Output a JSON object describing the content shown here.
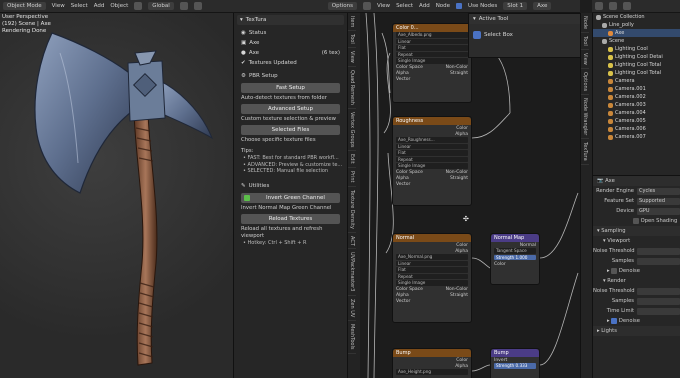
{
  "topbar": {
    "mode": "Object Mode",
    "menus": [
      "View",
      "Select",
      "Add",
      "Object"
    ],
    "orientation": "Global",
    "options": "Options"
  },
  "viewport": {
    "lines": [
      "User Perspective",
      "(192) Scene | Axe",
      "Rendering Done"
    ]
  },
  "panel": {
    "title": "TexTura",
    "status_title": "Status",
    "object_name": "Axe",
    "material_name": "Axe",
    "tex_count": "(6 tex)",
    "textures_updated": "Textures Updated",
    "pbr_title": "PBR Setup",
    "fast_setup": "Fast Setup",
    "fast_desc": "Auto-detect textures from folder",
    "advanced_setup": "Advanced Setup",
    "advanced_desc": "Custom texture selection & preview",
    "selected_files": "Selected Files",
    "selected_desc": "Choose specific texture files",
    "tips_label": "Tips:",
    "tips": [
      "• FAST: Best for standard PBR workfl...",
      "• ADVANCED: Preview & customize te...",
      "• SELECTED: Manual file selection"
    ],
    "utilities_title": "Utilities",
    "invert_green": "Invert Green Channel",
    "invert_desc": "Invert Normal Map Green Channel",
    "reload_textures": "Reload Textures",
    "reload_desc": "Reload all textures and refresh viewport",
    "hotkey": "• Hotkey: Ctrl + Shift + R"
  },
  "side_tabs": [
    "Item",
    "Tool",
    "View",
    "Quad Remesh",
    "Vertex Groups",
    "Edit",
    "Print",
    "Texture Density",
    "ACT",
    "UVPackmaster3",
    "Zen UV",
    "MeshTools"
  ],
  "node_editor": {
    "menus": [
      "View",
      "Select",
      "Add",
      "Node"
    ],
    "use_nodes": "Use Nodes",
    "slot": "Slot 1",
    "material": "Axe",
    "color_node": {
      "title": "Color 0...",
      "file": "Axe_Albedo.png"
    },
    "roughness_node": {
      "title": "Roughness",
      "file": "Axe_Roughness..."
    },
    "normal_node": {
      "title": "Normal",
      "file": "Axe_Normal.png"
    },
    "bump_node": {
      "title": "Bump",
      "file": "Axe_Height.png"
    },
    "fields": [
      "Linear",
      "Flat",
      "Repeat",
      "Single Image"
    ],
    "color_space_label": "Color Space",
    "color_space_value": "Non-Color",
    "alpha_label": "Alpha",
    "alpha_value": "Straight",
    "vector_label": "Vector",
    "out_color": "Color",
    "out_alpha": "Alpha",
    "normal_map": {
      "title": "Normal Map",
      "space": "Tangent Space",
      "strength_label": "Strength",
      "strength_value": "1.000",
      "out": "Normal",
      "in": "Color"
    },
    "bump": {
      "title": "Bump",
      "invert": "Invert",
      "strength_label": "Strength",
      "strength_value": "0.333"
    }
  },
  "active_tool": {
    "title": "Active Tool",
    "tool": "Select Box"
  },
  "right_tabs": [
    "Node",
    "Tool",
    "View",
    "Options",
    "Node Wrangler",
    "TexTura"
  ],
  "outliner": {
    "items": [
      {
        "label": "Scene Collection",
        "indent": 0
      },
      {
        "label": "Line_polly",
        "indent": 1
      },
      {
        "label": "Axe",
        "indent": 2,
        "selected": true
      },
      {
        "label": "Scene",
        "indent": 1
      },
      {
        "label": "Lighting Cool",
        "indent": 2
      },
      {
        "label": "Lighting Cool Detai",
        "indent": 2
      },
      {
        "label": "Lighting Cool Total",
        "indent": 2
      },
      {
        "label": "Lighting Cool Total",
        "indent": 2
      },
      {
        "label": "Camera",
        "indent": 2
      },
      {
        "label": "Camera.001",
        "indent": 2
      },
      {
        "label": "Camera.002",
        "indent": 2
      },
      {
        "label": "Camera.003",
        "indent": 2
      },
      {
        "label": "Camera.004",
        "indent": 2
      },
      {
        "label": "Camera.005",
        "indent": 2
      },
      {
        "label": "Camera.006",
        "indent": 2
      },
      {
        "label": "Camera.007",
        "indent": 2
      }
    ]
  },
  "properties": {
    "object": "Axe",
    "render_engine_label": "Render Engine",
    "render_engine": "Cycles",
    "feature_set_label": "Feature Set",
    "feature_set": "Supported",
    "device_label": "Device",
    "device": "GPU",
    "open_shading": "Open Shading",
    "sampling": "Sampling",
    "viewport": "Viewport",
    "noise_threshold_label": "Noise Threshold",
    "samples_label": "Samples",
    "denoise": "Denoise",
    "render": "Render",
    "time_limit_label": "Time Limit",
    "lights": "Lights"
  },
  "colors": {
    "image_node_header": "#7a4a18",
    "vector_node_header": "#4b3c86",
    "socket_yellow": "#c7c729",
    "socket_gray": "#a1a1a1",
    "socket_purple": "#6363c7",
    "accent_blue": "#4a72c4"
  }
}
